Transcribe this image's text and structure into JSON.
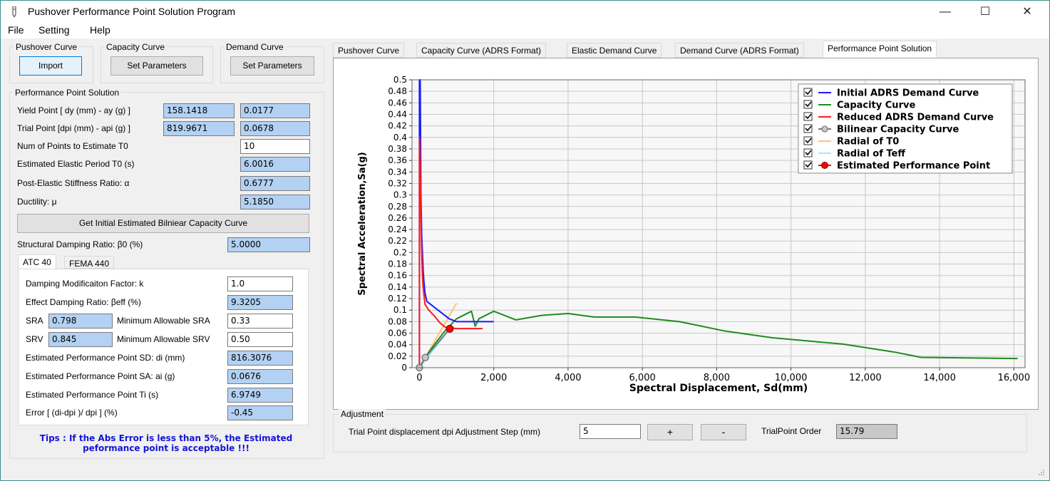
{
  "window": {
    "title": "Pushover Performance Point Solution Program",
    "controls": {
      "minimize": "—",
      "maximize": "☐",
      "close": "✕"
    }
  },
  "menu": {
    "file": "File",
    "setting": "Setting",
    "help": "Help"
  },
  "left": {
    "pushover_group": "Pushover Curve",
    "import_btn": "Import",
    "capacity_group": "Capacity Curve",
    "capacity_btn": "Set Parameters",
    "demand_group": "Demand Curve",
    "demand_btn": "Set Parameters",
    "pps_group": "Performance Point Solution",
    "yield_label": "Yield Point [ dy (mm) - ay (g) ]",
    "yield_dy": "158.1418",
    "yield_ay": "0.0177",
    "trial_label": "Trial Point [dpi (mm) - api (g) ]",
    "trial_dpi": "819.9671",
    "trial_api": "0.0678",
    "num_points_label": "Num of Points to Estimate T0",
    "num_points": "10",
    "period_label": "Estimated Elastic Period T0 (s)",
    "period": "6.0016",
    "stiffness_label": "Post-Elastic Stiffness Ratio: α",
    "stiffness": "0.6777",
    "ductility_label": "Ductility: μ",
    "ductility": "5.1850",
    "bilinear_btn": "Get Initial Estimated Bilniear Capacity Curve",
    "damping_label": "Structural Damping Ratio: β0 (%)",
    "damping": "5.0000",
    "tabs": {
      "atc40": "ATC 40",
      "fema440": "FEMA 440"
    },
    "k_label": "Damping Modificaiton Factor: k",
    "k": "1.0",
    "beff_label": "Effect Damping Ratio: βeff (%)",
    "beff": "9.3205",
    "sra_label": "SRA",
    "sra": "0.798",
    "min_sra_label": "Minimum Allowable SRA",
    "min_sra": "0.33",
    "srv_label": "SRV",
    "srv": "0.845",
    "min_srv_label": "Minimum Allowable SRV",
    "min_srv": "0.50",
    "sd_label": "Estimated Performance Point SD: di (mm)",
    "sd": "816.3076",
    "sa_label": "Estimated Performance Point SA: ai (g)",
    "sa": "0.0676",
    "ti_label": "Estimated Performance Point Ti (s)",
    "ti": "6.9749",
    "error_label": "Error [ (di-dpi )/ dpi ] (%)",
    "error": "-0.45",
    "tips_line1": "Tips : If the Abs Error is less than 5%, the Estimated",
    "tips_line2": "peformance point is acceptable !!!"
  },
  "right": {
    "tabs": [
      {
        "label": "Pushover Curve"
      },
      {
        "label": "Capacity Curve (ADRS Format)"
      },
      {
        "label": "Elastic Demand Curve"
      },
      {
        "label": "Demand Curve (ADRS Format)"
      },
      {
        "label": "Performance Point Solution",
        "active": true
      }
    ],
    "adjust_group": "Adjustment",
    "step_label": "Trial Point displacement dpi Adjustment Step (mm)",
    "step": "5",
    "plus_btn": "+",
    "minus_btn": "-",
    "order_label": "TrialPoint Order",
    "order": "15.79"
  },
  "chart_data": {
    "type": "line",
    "xlabel": "Spectral Displacement, Sd(mm)",
    "ylabel": "Spectral Acceleration,Sa(g)",
    "xlim": [
      -200,
      16300
    ],
    "ylim": [
      0,
      0.5
    ],
    "xticks": [
      0,
      2000,
      4000,
      6000,
      8000,
      10000,
      12000,
      14000,
      16000
    ],
    "xtick_labels": [
      "0",
      "2,000",
      "4,000",
      "6,000",
      "8,000",
      "10,000",
      "12,000",
      "14,000",
      "16,000"
    ],
    "yticks": [
      0,
      0.02,
      0.04,
      0.06,
      0.08,
      0.1,
      0.12,
      0.14,
      0.16,
      0.18,
      0.2,
      0.22,
      0.24,
      0.26,
      0.28,
      0.3,
      0.32,
      0.34,
      0.36,
      0.38,
      0.4,
      0.42,
      0.44,
      0.46,
      0.48,
      0.5
    ],
    "ytick_labels": [
      "0",
      "0.02",
      "0.04",
      "0.06",
      "0.08",
      "0.1",
      "0.12",
      "0.14",
      "0.16",
      "0.18",
      "0.2",
      "0.22",
      "0.24",
      "0.26",
      "0.28",
      "0.3",
      "0.32",
      "0.34",
      "0.36",
      "0.38",
      "0.4",
      "0.42",
      "0.44",
      "0.46",
      "0.48",
      "0.5"
    ],
    "grid": true,
    "legend_position": "top-right",
    "series": [
      {
        "name": "Initial ADRS Demand Curve",
        "color": "#1a1aff",
        "marker": "none",
        "x": [
          0,
          0,
          20,
          30,
          40,
          50,
          60,
          80,
          100,
          120,
          150,
          200,
          300,
          400,
          600,
          800,
          1000,
          1500,
          2000
        ],
        "y": [
          0,
          0.5,
          0.5,
          0.4,
          0.3,
          0.27,
          0.23,
          0.2,
          0.17,
          0.15,
          0.13,
          0.115,
          0.11,
          0.105,
          0.095,
          0.085,
          0.08,
          0.08,
          0.08
        ]
      },
      {
        "name": "Capacity Curve",
        "color": "#1e8c1e",
        "marker": "none",
        "x": [
          0,
          150,
          400,
          700,
          1000,
          1400,
          1500,
          1600,
          2000,
          2600,
          3300,
          4000,
          4700,
          5800,
          7000,
          8200,
          9500,
          11400,
          12800,
          13500,
          16100
        ],
        "y": [
          0,
          0.018,
          0.04,
          0.065,
          0.085,
          0.098,
          0.072,
          0.085,
          0.098,
          0.083,
          0.091,
          0.094,
          0.088,
          0.088,
          0.08,
          0.064,
          0.052,
          0.041,
          0.027,
          0.018,
          0.016
        ]
      },
      {
        "name": "Reduced ADRS Demand Curve",
        "color": "#ff1a1a",
        "marker": "none",
        "x": [
          0,
          0,
          10,
          20,
          30,
          40,
          50,
          60,
          80,
          100,
          150,
          250,
          400,
          550,
          700,
          1000,
          1700
        ],
        "y": [
          0,
          0.4,
          0.38,
          0.35,
          0.31,
          0.27,
          0.23,
          0.2,
          0.16,
          0.14,
          0.11,
          0.1,
          0.09,
          0.078,
          0.07,
          0.068,
          0.068
        ]
      },
      {
        "name": "Bilinear Capacity Curve",
        "color": "#7a7a7a",
        "marker": "circle",
        "x": [
          0,
          158.1418,
          819.9671
        ],
        "y": [
          0,
          0.0177,
          0.0678
        ]
      },
      {
        "name": "Radial of T0",
        "color": "#ffbf7f",
        "marker": "none",
        "x": [
          0,
          1000
        ],
        "y": [
          0,
          0.112
        ]
      },
      {
        "name": "Radial of Teff",
        "color": "#8fefff",
        "marker": "none",
        "x": [
          0,
          816.3076
        ],
        "y": [
          0,
          0.0676
        ]
      },
      {
        "name": "Estimated Performance Point",
        "color": "#ff0000",
        "marker": "filled-circle",
        "x": [
          816.3076
        ],
        "y": [
          0.0676
        ]
      }
    ]
  }
}
